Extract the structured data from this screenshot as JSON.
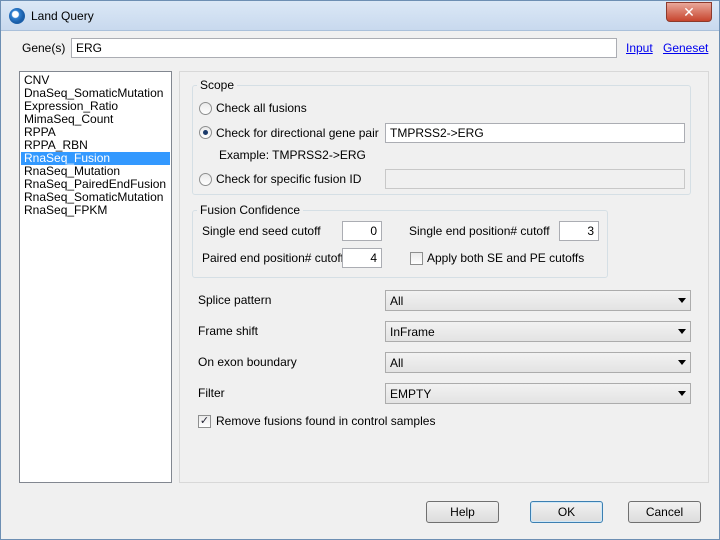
{
  "window": {
    "title": "Land Query",
    "close_glyph": "✕"
  },
  "gene": {
    "label": "Gene(s)",
    "value": "ERG",
    "links": [
      "Input",
      "Geneset"
    ]
  },
  "datasets": [
    "CNV",
    "DnaSeq_SomaticMutation",
    "Expression_Ratio",
    "MimaSeq_Count",
    "RPPA",
    "RPPA_RBN",
    "RnaSeq_Fusion",
    "RnaSeq_Mutation",
    "RnaSeq_PairedEndFusion",
    "RnaSeq_SomaticMutation",
    "RnaSeq_FPKM"
  ],
  "selected_dataset": "RnaSeq_Fusion",
  "scope": {
    "title": "Scope",
    "check_all_label": "Check all fusions",
    "directional_label": "Check for directional gene pair",
    "directional_value": "TMPRSS2->ERG",
    "example": "Example: TMPRSS2->ERG",
    "specific_label": "Check for specific fusion ID",
    "specific_value": "",
    "selected": "directional"
  },
  "confidence": {
    "title": "Fusion Confidence",
    "se_seed_label": "Single end seed cutoff",
    "se_seed_value": "0",
    "se_pos_label": "Single end position# cutoff",
    "se_pos_value": "3",
    "pe_pos_label": "Paired end position# cutoff",
    "pe_pos_value": "4",
    "apply_both_label": "Apply both SE and PE cutoffs",
    "apply_both_checked": false
  },
  "options": {
    "splice_label": "Splice pattern",
    "splice_value": "All",
    "frame_label": "Frame shift",
    "frame_value": "InFrame",
    "exon_label": "On exon boundary",
    "exon_value": "All",
    "filter_label": "Filter",
    "filter_value": "EMPTY",
    "remove_label": "Remove fusions found in control samples",
    "remove_checked": true
  },
  "buttons": {
    "help": "Help",
    "ok": "OK",
    "cancel": "Cancel"
  }
}
